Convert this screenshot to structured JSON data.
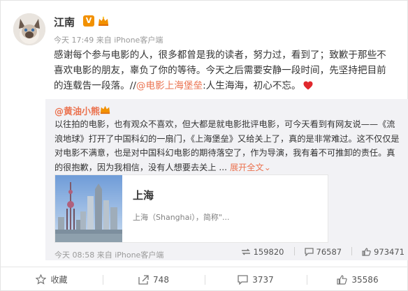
{
  "post": {
    "author": "江南",
    "verified_badge": "V",
    "meta": "今天 17:49 来自 iPhone客户端",
    "text_before_link": "感谢每个参与电影的人，很多都曾是我的读者，努力过，看到了；致歉于那些不喜欢电影的朋友，辜负了你的等待。今天之后需要安静一段时间，先坚持把目前的连载告一段落。//",
    "link_text": "@电影上海堡垒",
    "text_after_link": ":人生海海，初心不忘。"
  },
  "repost": {
    "author": "@黄油小熊",
    "text": "以往拍的电影，也有观众不喜欢，但大都是就电影批评电影，可今天看到有网友说——《流浪地球》打开了中国科幻的一扇门，《上海堡垒》又给关上了，真的是非常难过。这不仅仅是对电影不满意，也是对中国科幻电影的期待落空了，作为导演，我有着不可推卸的责任。真的很抱歉，因为我相信，没有人想要去关上 ... ",
    "expand_label": "展开全文",
    "expand_arrow": "⌄",
    "card_title": "上海",
    "card_desc": "上海（Shanghai），简称\"...",
    "meta": "今天 08:58 来自 iPhone客户端",
    "reposts": "159820",
    "comments": "76587",
    "likes": "973471"
  },
  "actions": {
    "favorite": "收藏",
    "repost": "748",
    "comment": "3737",
    "like": "35586"
  },
  "colors": {
    "accent": "#eb7350",
    "verified": "#f29100",
    "heart": "#e0282d"
  }
}
